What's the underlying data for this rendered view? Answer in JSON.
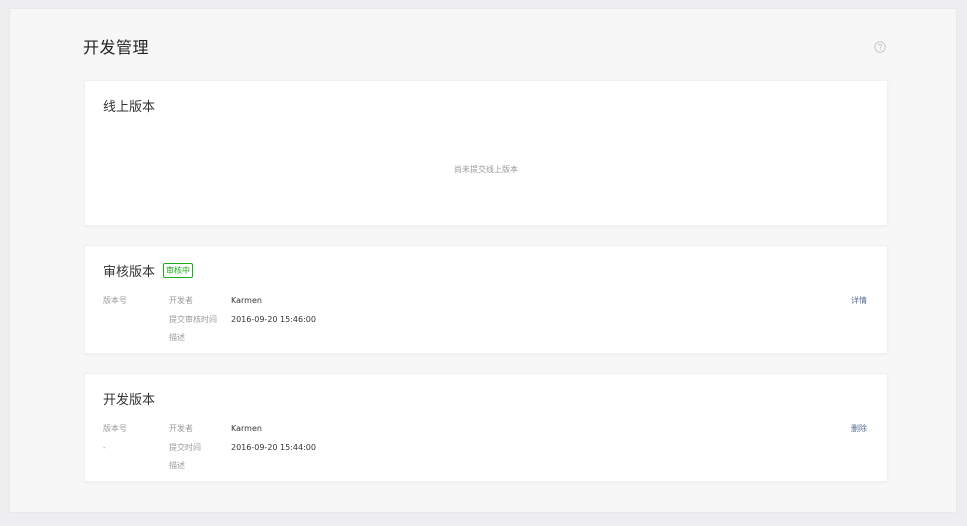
{
  "page": {
    "title": "开发管理",
    "help_icon": "help-icon"
  },
  "online_version": {
    "title": "线上版本",
    "empty_text": "尚未提交线上版本"
  },
  "review_version": {
    "title": "审核版本",
    "status_badge": "审核中",
    "labels": {
      "version": "版本号",
      "developer": "开发者",
      "time": "提交审核时间",
      "desc": "描述"
    },
    "values": {
      "version": "",
      "developer": "Karmen",
      "time": "2016-09-20 15:46:00",
      "desc": ""
    },
    "action": "详情"
  },
  "dev_version": {
    "title": "开发版本",
    "labels": {
      "version": "版本号",
      "developer": "开发者",
      "time": "提交时间",
      "desc": "描述"
    },
    "values": {
      "version": "-",
      "developer": "Karmen",
      "time": "2016-09-20 15:44:00",
      "desc": ""
    },
    "action": "删除"
  },
  "colors": {
    "accent_green": "#1aad19",
    "link_blue": "#576b95"
  }
}
